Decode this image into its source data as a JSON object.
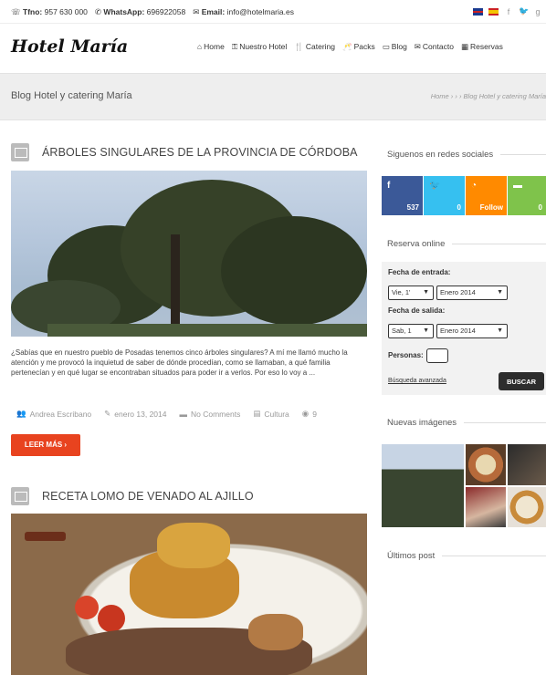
{
  "topbar": {
    "phone_label": "Tfno:",
    "phone": "957 630 000",
    "whatsapp_label": "WhatsApp:",
    "whatsapp": "696922058",
    "email_label": "Email:",
    "email": "info@hotelmaria.es"
  },
  "header": {
    "logo": "Hotel María",
    "nav": [
      "Home",
      "Nuestro Hotel",
      "Catering",
      "Packs",
      "Blog",
      "Contacto",
      "Reservas"
    ]
  },
  "titlebar": {
    "title": "Blog Hotel y catering María",
    "breadcrumb": "Home › › › Blog Hotel y catering María"
  },
  "posts": [
    {
      "title": "ÁRBOLES SINGULARES DE LA PROVINCIA DE CÓRDOBA",
      "excerpt": "¿Sabías que en nuestro pueblo de Posadas tenemos cinco árboles singulares? A mí me llamó mucho la atención y  me provocó la inquietud  de  saber de dónde  procedían, como se llamaban, a qué familia pertenecían y en qué lugar se encontraban situados para poder ir a verlos. Por eso lo voy a ...",
      "author": "Andrea Escribano",
      "date": "enero 13, 2014",
      "comments": "No Comments",
      "category": "Cultura",
      "views": "9",
      "read_more": "LEER MÁS  ›"
    },
    {
      "title": "RECETA LOMO DE VENADO AL AJILLO"
    }
  ],
  "sidebar": {
    "social_heading": "Siguenos en redes sociales",
    "social": [
      {
        "name": "facebook",
        "icon": "f",
        "count": "537",
        "color": "#3b5998"
      },
      {
        "name": "twitter",
        "icon": "t",
        "count": "0",
        "color": "#36c0f0"
      },
      {
        "name": "rss",
        "icon": "rss",
        "count": "Follow",
        "color": "#ff8a00"
      },
      {
        "name": "comments",
        "icon": "msg",
        "count": "0",
        "color": "#7fc34b"
      }
    ],
    "reserva_heading": "Reserva online",
    "fecha_entrada_label": "Fecha de entrada:",
    "entrada_day": "Vie, 1'",
    "entrada_month": "Enero 2014",
    "fecha_salida_label": "Fecha de salida:",
    "salida_day": "Sab, 1",
    "salida_month": "Enero 2014",
    "personas_label": "Personas:",
    "advanced_search": "Búsqueda avanzada",
    "search_button": "BUSCAR",
    "images_heading": "Nuevas imágenes",
    "posts_heading": "Últimos post"
  },
  "colors": {
    "accent": "#e8431f",
    "dark_button": "#2d2d2d"
  }
}
